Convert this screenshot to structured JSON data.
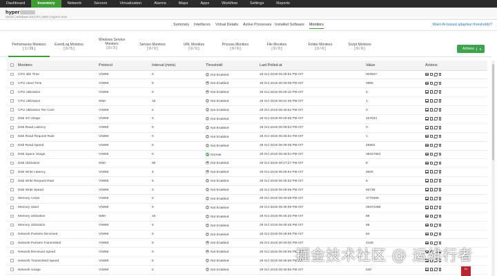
{
  "nav": {
    "items": [
      "Dashboard",
      "Inventory",
      "Network",
      "Servers",
      "Virtualization",
      "Alarms",
      "Maps",
      "Apps",
      "Workflow",
      "Settings",
      "Reports"
    ],
    "active": "Inventory"
  },
  "host": {
    "name": "hyper",
    "subtitle": "Server | Windows 2012 R2 | WMI | HyperV Host"
  },
  "subtabs": {
    "items": [
      "Summary",
      "Interfaces",
      "Virtual Details",
      "Active Processes",
      "Installed Software",
      "Monitors"
    ],
    "active": "Monitors",
    "adaptive_link": "Want AI-based adaptive thresholds?"
  },
  "categories": [
    {
      "label": "Performance Monitors",
      "count": "[ 1 / 26 ]"
    },
    {
      "label": "EventLog Monitors",
      "count": "[ 0 / 5 ]"
    },
    {
      "label": "Windows Service Monitors",
      "count": "[ 0 / 3 ]"
    },
    {
      "label": "Service Monitors",
      "count": "[ 0 / 0 ]"
    },
    {
      "label": "URL Monitors",
      "count": "[ 0 / 0 ]"
    },
    {
      "label": "Process Monitors",
      "count": "[ 0 / 0 ]"
    },
    {
      "label": "File Monitors",
      "count": "[ 0 / 0 ]"
    },
    {
      "label": "Folder Monitors",
      "count": "[ 0 / 0 ]"
    },
    {
      "label": "Script Monitors",
      "count": "[ 0 / 0 ]"
    }
  ],
  "actions_label": "Actions",
  "table": {
    "headers": {
      "monitors": "Monitors",
      "protocol": "Protocol",
      "interval": "Interval (mins)",
      "threshold": "Threshold",
      "last_polled": "Last Polled at",
      "value": "Value",
      "actions": "Actions"
    },
    "rows": [
      {
        "monitor": "CPU Idle Time",
        "protocol": "VIWMI",
        "interval": "5",
        "threshold": "Not Enabled",
        "polled": "29 Oct 2019 09:48:52 PM IST",
        "value": "303947",
        "status": "off"
      },
      {
        "monitor": "CPU Used Time",
        "protocol": "VIWMI",
        "interval": "5",
        "threshold": "Not Enabled",
        "polled": "29 Oct 2019 09:49:08 PM IST",
        "value": "3885",
        "status": "off"
      },
      {
        "monitor": "CPU Utilization",
        "protocol": "VIWMI",
        "interval": "5",
        "threshold": "Not Enabled",
        "polled": "29 Oct 2019 09:49:10 PM IST",
        "value": "2",
        "status": "off"
      },
      {
        "monitor": "CPU Utilization",
        "protocol": "WMI",
        "interval": "15",
        "threshold": "Not Enabled",
        "polled": "29 Oct 2019 09:44:49 PM IST",
        "value": "1",
        "status": "off"
      },
      {
        "monitor": "CPU Utilization Per Core",
        "protocol": "VIWMI",
        "interval": "5",
        "threshold": "Not Enabled",
        "polled": "29 Oct 2019 09:48:52 PM IST",
        "value": "0",
        "status": "off"
      },
      {
        "monitor": "Disk I/O Usage",
        "protocol": "VIWMI",
        "interval": "5",
        "threshold": "Not Enabled",
        "polled": "29 Oct 2019 09:49:08 PM IST",
        "value": "107634",
        "status": "off"
      },
      {
        "monitor": "Disk Read Latency",
        "protocol": "VIWMI",
        "interval": "5",
        "threshold": "Not Enabled",
        "polled": "29 Oct 2019 09:48:54 PM IST",
        "value": "0",
        "status": "off"
      },
      {
        "monitor": "Disk Read Request Rate",
        "protocol": "VIWMI",
        "interval": "5",
        "threshold": "Not Enabled",
        "polled": "29 Oct 2019 09:48:52 PM IST",
        "value": "1",
        "status": "off"
      },
      {
        "monitor": "Disk Read Speed",
        "protocol": "VIWMI",
        "interval": "5",
        "threshold": "Not Enabled",
        "polled": "29 Oct 2019 09:49:08 PM IST",
        "value": "46954",
        "status": "off"
      },
      {
        "monitor": "Disk Space Usage",
        "protocol": "VIWMI",
        "interval": "5",
        "threshold": "Normal",
        "polled": "29 Oct 2019 09:48:54 PM IST",
        "value": "39337654",
        "status": "ok"
      },
      {
        "monitor": "Disk Utilization",
        "protocol": "WMI",
        "interval": "60",
        "threshold": "Not Enabled",
        "polled": "29 Oct 2019 09:17:27 PM IST",
        "value": "8",
        "status": "off"
      },
      {
        "monitor": "Disk Write Latency",
        "protocol": "VIWMI",
        "interval": "5",
        "threshold": "Not Enabled",
        "polled": "29 Oct 2019 09:48:54 PM IST",
        "value": "9000",
        "status": "off"
      },
      {
        "monitor": "Disk Write Request Rate",
        "protocol": "VIWMI",
        "interval": "5",
        "threshold": "Not Enabled",
        "polled": "29 Oct 2019 09:48:52 PM IST",
        "value": "5",
        "status": "off"
      },
      {
        "monitor": "Disk Write Speed",
        "protocol": "VIWMI",
        "interval": "5",
        "threshold": "Not Enabled",
        "polled": "29 Oct 2019 09:49:08 PM IST",
        "value": "60736",
        "status": "off"
      },
      {
        "monitor": "Memory Active",
        "protocol": "VIWMI",
        "interval": "5",
        "threshold": "Not Enabled",
        "polled": "29 Oct 2019 09:49:08 PM IST",
        "value": "3776308",
        "status": "off"
      },
      {
        "monitor": "Memory Used",
        "protocol": "VIWMI",
        "interval": "5",
        "threshold": "Not Enabled",
        "polled": "29 Oct 2019 09:49:08 PM IST",
        "value": "29374296",
        "status": "off"
      },
      {
        "monitor": "Memory Utilization",
        "protocol": "WMI",
        "interval": "15",
        "threshold": "Not Enabled",
        "polled": "29 Oct 2019 09:45:20 PM IST",
        "value": "89",
        "status": "off"
      },
      {
        "monitor": "Memory Utilization",
        "protocol": "VIWMI",
        "interval": "5",
        "threshold": "Not Enabled",
        "polled": "29 Oct 2019 09:49:08 PM IST",
        "value": "88",
        "status": "off"
      },
      {
        "monitor": "Network Packets Received",
        "protocol": "VIWMI",
        "interval": "5",
        "threshold": "Not Enabled",
        "polled": "29 Oct 2019 09:48:58 PM IST",
        "value": "94",
        "status": "off"
      },
      {
        "monitor": "Network Packets Transmitted",
        "protocol": "VIWMI",
        "interval": "5",
        "threshold": "Not Enabled",
        "polled": "29 Oct 2019 09:49:00 PM IST",
        "value": "4169",
        "status": "off"
      },
      {
        "monitor": "Network Received Speed",
        "protocol": "VIWMI",
        "interval": "5",
        "threshold": "Not Enabled",
        "polled": "29 Oct 2019 09:48:56 PM IST",
        "value": "1",
        "status": "off"
      },
      {
        "monitor": "Network Transmitted Speed",
        "protocol": "VIWMI",
        "interval": "5",
        "threshold": "Not Enabled",
        "polled": "29 Oct 2019 09:48:58 PM IST",
        "value": "",
        "status": "off"
      },
      {
        "monitor": "Network Usage",
        "protocol": "VIWMI",
        "interval": "5",
        "threshold": "Not Enabled",
        "polled": "29 Oct 2019 09:48:56 PM IST",
        "value": "630",
        "status": "off"
      }
    ]
  },
  "watermark": "掘金技术社区 @ 运维行者",
  "corner_badge": "51"
}
